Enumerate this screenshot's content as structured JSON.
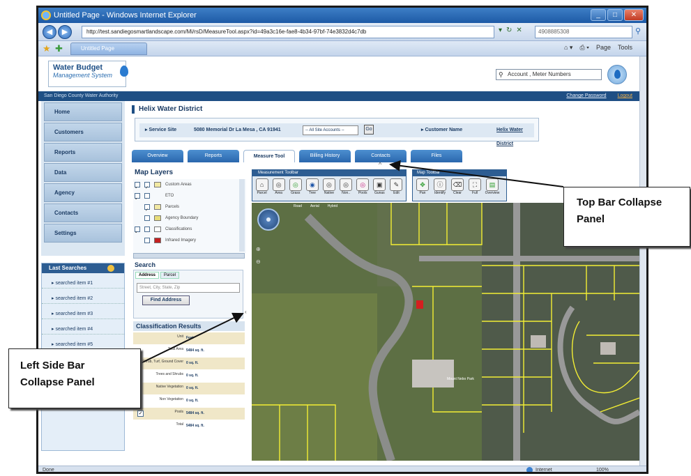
{
  "browser": {
    "title": "Untitled Page - Windows Internet Explorer",
    "url": "http://test.sandiegosmartlandscape.com/Mi/rsD/MeasureTool.aspx?id=49a3c16e-fae8-4b34-97bf-74e3832d4c7db",
    "search_value": "4908885308",
    "tab_label": "Untitled Page",
    "cmd_page": "Page",
    "cmd_tools": "Tools",
    "status_left": "Done",
    "status_zone": "Internet",
    "status_zoom": "100%"
  },
  "app": {
    "logo_line1": "Water Budget",
    "logo_line2": "Management System",
    "search_placeholder": "Account , Meter Numbers",
    "agency": "San Diego County Water Authority",
    "change_password": "Change Password",
    "logout": "Logout"
  },
  "nav": {
    "items": [
      "Home",
      "Customers",
      "Reports",
      "Data",
      "Agency",
      "Contacts",
      "Settings"
    ]
  },
  "last_searches": {
    "title": "Last Searches",
    "items": [
      "searched item #1",
      "searched item #2",
      "searched item #3",
      "searched item #4",
      "searched item #5"
    ]
  },
  "district": "Helix Water District",
  "site": {
    "service_label": "Service Site",
    "address": "5080 Memorial Dr La Mesa , CA 91941",
    "select_value": "-- All Site Accounts --",
    "go": "Go",
    "customer_label": "Customer Name",
    "customer_link": "Helix Water District"
  },
  "tabs": [
    "Overview",
    "Reports",
    "Measure Tool",
    "Billing History",
    "Contacts",
    "Files"
  ],
  "layers": {
    "title": "Map Layers",
    "items": [
      {
        "name": "Custom Areas",
        "color": "#f2e9a3"
      },
      {
        "name": "ETO",
        "color": "#ffffff"
      },
      {
        "name": "Parcels",
        "color": "#f2e9a3"
      },
      {
        "name": "Agency Boundary",
        "color": "#e8dd7a"
      },
      {
        "name": "Classifications",
        "color": "#ffffff"
      },
      {
        "name": "Infrared Imagery",
        "color": "#c42020"
      }
    ]
  },
  "search": {
    "title": "Search",
    "tab_address": "Address",
    "tab_parcel": "Parcel",
    "placeholder": "Street, City, State, Zip",
    "button": "Find Address"
  },
  "classification": {
    "title": "Classification Results",
    "rows": [
      {
        "label": "Unit",
        "value": "Feet"
      },
      {
        "label": "Total Area",
        "value": "5484 sq. ft."
      },
      {
        "label": "Shrub, Turf, Ground Cover",
        "value": "0 sq. ft."
      },
      {
        "label": "Trees and Shrubs",
        "value": "0 sq. ft."
      },
      {
        "label": "Native Vegetation",
        "value": "0 sq. ft."
      },
      {
        "label": "Non Vegetation",
        "value": "0 sq. ft."
      },
      {
        "label": "Pools",
        "value": "5484 sq. ft."
      },
      {
        "label": "Total",
        "value": "5484 sq. ft."
      }
    ]
  },
  "measurement_toolbar": {
    "title": "Measurement Toolbar",
    "tools": [
      "Parcel",
      "Area",
      "Grass",
      "Tree",
      "Native",
      "Non..",
      "Pools",
      "Gunas",
      "Edit"
    ]
  },
  "map_toolbar": {
    "title": "Map Toolbar",
    "tools": [
      "Pan",
      "Identify",
      "Clear",
      "Full",
      "Overview"
    ]
  },
  "map": {
    "top_labels": [
      "Road",
      "Aerial",
      "Hybrid"
    ],
    "park_label": "Mount Nebo Park"
  },
  "callouts": {
    "top": "Top Bar Collapse Panel",
    "left": "Left Side Bar Collapse Panel"
  }
}
